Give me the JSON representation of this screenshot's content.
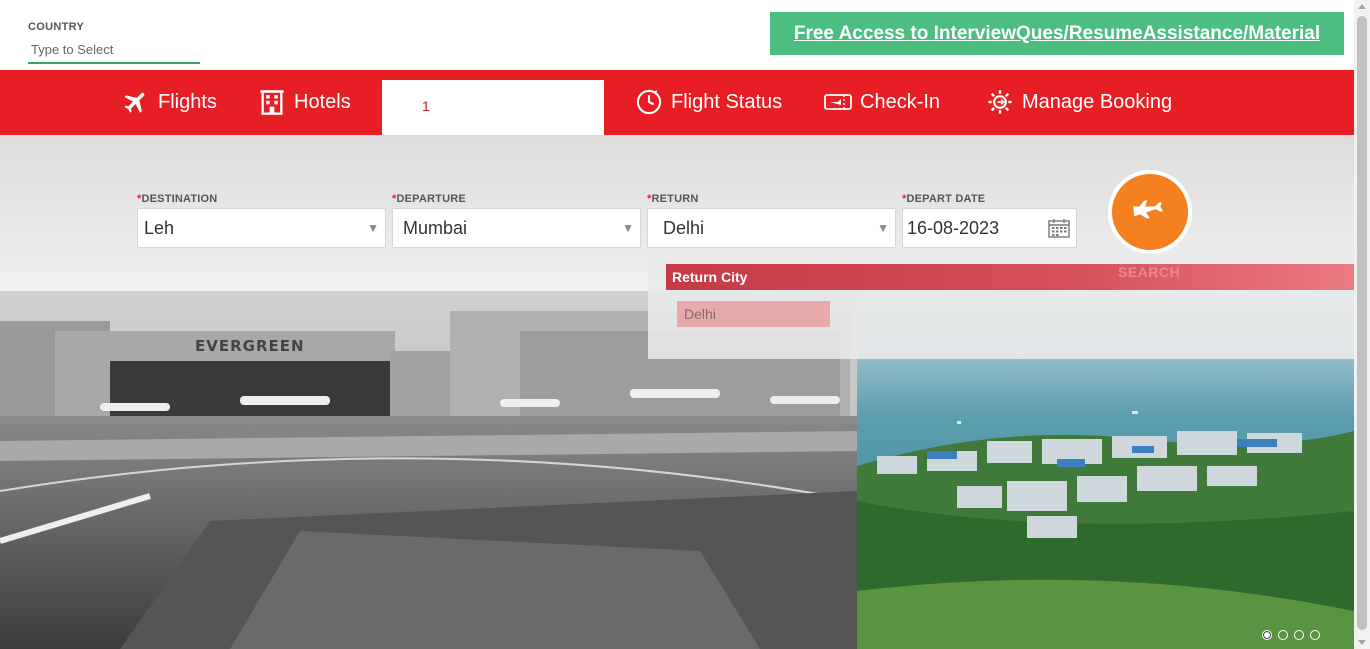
{
  "country": {
    "label": "COUNTRY",
    "placeholder": "Type to Select"
  },
  "promo": {
    "text": "Free Access to InterviewQues/ResumeAssistance/Material"
  },
  "nav": {
    "flights": "Flights",
    "hotels": "Hotels",
    "blank_mark": "1",
    "flight_status": "Flight Status",
    "check_in": "Check-In",
    "manage_booking": "Manage Booking"
  },
  "form": {
    "required_mark": "*",
    "destination": {
      "label": "DESTINATION",
      "value": "Leh"
    },
    "departure": {
      "label": "DEPARTURE",
      "value": "Mumbai"
    },
    "return": {
      "label": "RETURN",
      "value": "Delhi"
    },
    "depart_date": {
      "label": "DEPART DATE",
      "value": "16-08-2023"
    },
    "search_label": "SEARCH"
  },
  "dropdown": {
    "header": "Return City",
    "options": [
      "Delhi"
    ]
  },
  "hero": {
    "hangar_sign": "EVERGREEN",
    "slides": 4,
    "active_slide": 0
  },
  "colors": {
    "brand_red": "#e81e25",
    "promo_green": "#4cbf80",
    "search_orange": "#f5801f",
    "input_underline": "#3aa55b"
  },
  "icons": {
    "flights": "airplane-icon",
    "hotels": "hotel-building-icon",
    "flight_status": "clock-plane-icon",
    "check_in": "ticket-plane-icon",
    "manage_booking": "gear-plane-icon",
    "date": "calendar-icon",
    "search": "airplane-icon"
  }
}
